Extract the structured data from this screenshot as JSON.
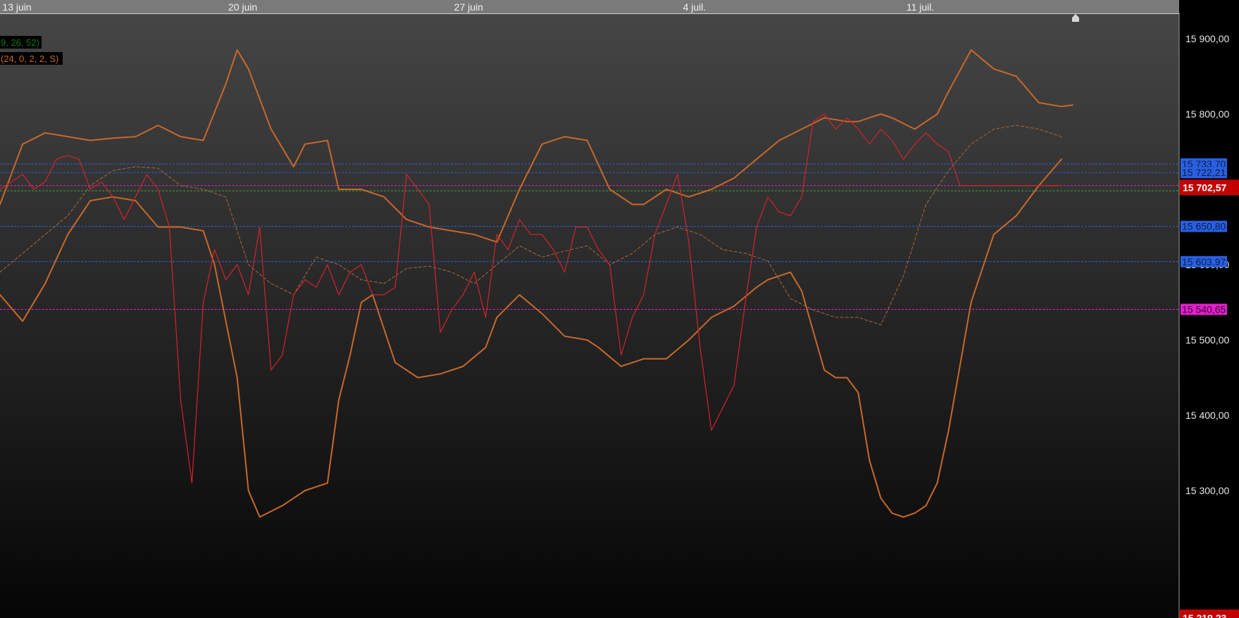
{
  "colors": {
    "bg_top": "#474747",
    "bg_bottom": "#050505",
    "date_bar": "#7a7a7a",
    "price_panel": "#000000",
    "bollinger": "#c8682a",
    "price_line": "#d4232a",
    "sma_dashed": "#a9683b",
    "blue_level": "#2a5fe0",
    "magenta_level": "#e020c8",
    "green_level": "#38a838",
    "last_price_bg": "#c40000",
    "legend_macd": "#0e7a0e",
    "legend_boll": "#c8682a"
  },
  "legend": {
    "macd_params": "9, 26, 52)",
    "bollinger_params": "(24, 0, 2, 2, S)"
  },
  "chart_data": {
    "type": "line",
    "x_axis": {
      "tick_labels": [
        "13 juin",
        "20 juin",
        "27 juin",
        "4 juil.",
        "11 juil."
      ],
      "tick_index": [
        3,
        43,
        83,
        123,
        163
      ]
    },
    "y_axis": {
      "range": [
        15219.23,
        15920.0
      ],
      "ticks": [
        15900,
        15800,
        15600,
        15500,
        15400,
        15300
      ],
      "tick_labels": [
        "15 900,00",
        "15 800,00",
        "15 600,00",
        "15 500,00",
        "15 400,00",
        "15 300,00"
      ]
    },
    "levels": [
      {
        "value": 15733.7,
        "label": "15 733,70",
        "style": "blue"
      },
      {
        "value": 15722.21,
        "label": "15 722,21",
        "style": "blue"
      },
      {
        "value": 15650.8,
        "label": "15 650,80",
        "style": "blue"
      },
      {
        "value": 15603.97,
        "label": "15 603,97",
        "style": "blue"
      },
      {
        "value": 15540.65,
        "label": "15 540,65",
        "style": "magenta"
      },
      {
        "value": 15705.0,
        "label": "",
        "style": "magenta_thin"
      },
      {
        "value": 15698.0,
        "label": "",
        "style": "green"
      }
    ],
    "last_price": {
      "value": 15702.57,
      "label": "15 702,57"
    },
    "bottom_price": {
      "value": 15219.23,
      "label": "15 219,23"
    },
    "series": [
      {
        "role": "bollinger_upper",
        "x": [
          0,
          4,
          8,
          12,
          16,
          20,
          24,
          28,
          32,
          36,
          40,
          42,
          44,
          48,
          52,
          54,
          58,
          60,
          64,
          68,
          72,
          76,
          80,
          84,
          88,
          92,
          96,
          100,
          104,
          108,
          112,
          114,
          118,
          122,
          126,
          130,
          134,
          138,
          142,
          146,
          150,
          152,
          156,
          158,
          162,
          166,
          168,
          172,
          176,
          180,
          184,
          188,
          190
        ],
        "values": [
          15680,
          15760,
          15775,
          15770,
          15765,
          15768,
          15770,
          15785,
          15770,
          15765,
          15840,
          15885,
          15860,
          15780,
          15730,
          15760,
          15765,
          15700,
          15700,
          15690,
          15660,
          15650,
          15645,
          15640,
          15630,
          15700,
          15760,
          15770,
          15765,
          15700,
          15680,
          15680,
          15700,
          15690,
          15700,
          15715,
          15740,
          15765,
          15780,
          15795,
          15790,
          15790,
          15800,
          15795,
          15780,
          15800,
          15830,
          15885,
          15860,
          15850,
          15815,
          15810,
          15812
        ]
      },
      {
        "role": "bollinger_lower",
        "x": [
          0,
          4,
          8,
          12,
          16,
          20,
          24,
          28,
          32,
          36,
          38,
          42,
          44,
          46,
          50,
          54,
          58,
          60,
          62,
          64,
          66,
          70,
          74,
          78,
          82,
          86,
          88,
          92,
          96,
          100,
          104,
          106,
          110,
          114,
          118,
          122,
          126,
          130,
          134,
          136,
          140,
          142,
          146,
          148,
          150,
          152,
          154,
          156,
          158,
          160,
          162,
          164,
          166,
          168,
          172,
          176,
          180,
          184,
          188
        ],
        "values": [
          15560,
          15525,
          15575,
          15640,
          15685,
          15690,
          15685,
          15650,
          15650,
          15645,
          15600,
          15450,
          15300,
          15265,
          15280,
          15300,
          15310,
          15420,
          15480,
          15550,
          15560,
          15470,
          15450,
          15455,
          15465,
          15490,
          15530,
          15560,
          15535,
          15505,
          15500,
          15490,
          15465,
          15475,
          15475,
          15500,
          15530,
          15545,
          15570,
          15580,
          15590,
          15565,
          15460,
          15450,
          15450,
          15430,
          15340,
          15290,
          15270,
          15265,
          15270,
          15280,
          15310,
          15380,
          15550,
          15640,
          15665,
          15705,
          15740
        ]
      },
      {
        "role": "sma",
        "x": [
          0,
          4,
          8,
          12,
          16,
          20,
          24,
          28,
          32,
          36,
          40,
          44,
          48,
          52,
          56,
          60,
          64,
          68,
          72,
          76,
          80,
          84,
          88,
          92,
          96,
          100,
          104,
          108,
          112,
          116,
          120,
          124,
          128,
          132,
          136,
          140,
          144,
          148,
          152,
          156,
          160,
          164,
          168,
          172,
          176,
          180,
          184,
          188
        ],
        "values": [
          15590,
          15615,
          15640,
          15665,
          15705,
          15725,
          15730,
          15728,
          15705,
          15700,
          15690,
          15600,
          15575,
          15560,
          15610,
          15600,
          15580,
          15575,
          15595,
          15598,
          15590,
          15575,
          15600,
          15625,
          15610,
          15618,
          15625,
          15600,
          15615,
          15640,
          15650,
          15640,
          15620,
          15615,
          15605,
          15555,
          15540,
          15530,
          15530,
          15520,
          15585,
          15680,
          15725,
          15760,
          15780,
          15785,
          15780,
          15770
        ]
      },
      {
        "role": "price",
        "x": [
          0,
          2,
          4,
          6,
          8,
          10,
          12,
          14,
          16,
          18,
          20,
          22,
          24,
          26,
          28,
          30,
          32,
          34,
          36,
          38,
          40,
          42,
          44,
          46,
          48,
          50,
          52,
          54,
          56,
          58,
          60,
          62,
          64,
          66,
          68,
          70,
          72,
          74,
          76,
          78,
          80,
          82,
          84,
          86,
          88,
          90,
          92,
          94,
          96,
          98,
          100,
          102,
          104,
          106,
          108,
          110,
          112,
          114,
          116,
          118,
          120,
          122,
          124,
          126,
          128,
          130,
          132,
          134,
          136,
          138,
          140,
          142,
          144,
          146,
          148,
          150,
          152,
          154,
          156,
          158,
          160,
          162,
          164,
          166,
          168,
          170,
          172,
          174,
          176,
          178,
          180,
          182,
          184,
          186,
          188
        ],
        "values": [
          15700,
          15710,
          15720,
          15700,
          15710,
          15740,
          15745,
          15740,
          15700,
          15710,
          15690,
          15660,
          15690,
          15720,
          15700,
          15650,
          15420,
          15310,
          15550,
          15620,
          15580,
          15600,
          15560,
          15650,
          15460,
          15480,
          15560,
          15580,
          15570,
          15600,
          15560,
          15590,
          15600,
          15560,
          15560,
          15570,
          15720,
          15700,
          15680,
          15510,
          15540,
          15560,
          15590,
          15530,
          15640,
          15620,
          15660,
          15640,
          15640,
          15620,
          15590,
          15650,
          15650,
          15620,
          15600,
          15480,
          15530,
          15560,
          15640,
          15680,
          15720,
          15630,
          15490,
          15380,
          15410,
          15440,
          15550,
          15650,
          15690,
          15670,
          15665,
          15690,
          15790,
          15800,
          15780,
          15795,
          15780,
          15760,
          15780,
          15765,
          15740,
          15760,
          15775,
          15760,
          15750,
          15705,
          15705,
          15705,
          15705,
          15705,
          15705,
          15705,
          15705,
          15705,
          15705
        ]
      }
    ]
  }
}
